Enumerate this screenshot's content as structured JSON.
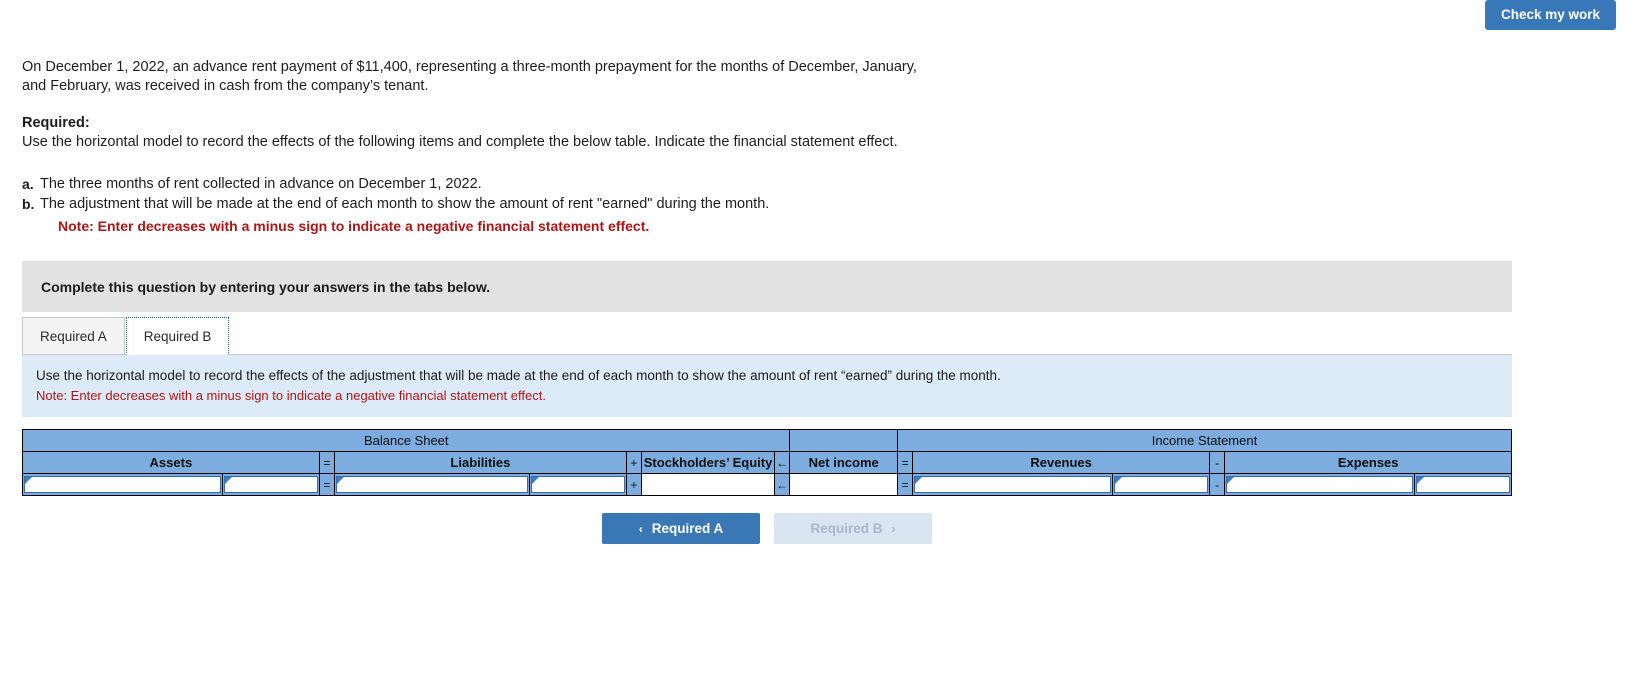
{
  "toolbar": {
    "check_my_work_label": "Check my work"
  },
  "prompt": {
    "paragraph": "On December 1, 2022, an advance rent payment of $11,400, representing a three-month prepayment for the months of December, January, and February, was received in cash from the company’s tenant.",
    "required_title": "Required:",
    "required_text": "Use the horizontal model to record the effects of the following items and complete the below table. Indicate the financial statement effect.",
    "items": [
      {
        "marker": "a.",
        "text": "The three months of rent collected in advance on December 1, 2022."
      },
      {
        "marker": "b.",
        "text": "The adjustment that will be made at the end of each month to show the amount of rent \"earned\" during the month."
      }
    ],
    "note": "Note: Enter decreases with a minus sign to indicate a negative financial statement effect."
  },
  "instruction_bar": {
    "text": "Complete this question by entering your answers in the tabs below."
  },
  "tabs": [
    {
      "label": "Required A",
      "active": false
    },
    {
      "label": "Required B",
      "active": true
    }
  ],
  "info_band": {
    "line1": "Use the horizontal model to record the effects of the adjustment that will be made at the end of each month to show the amount of rent “earned” during the month.",
    "line2": "Note: Enter decreases with a minus sign to indicate a negative financial statement effect."
  },
  "table": {
    "groups": [
      {
        "label": "Balance Sheet"
      },
      {
        "label": "Income Statement"
      }
    ],
    "columns": [
      {
        "label": "Assets",
        "operator_after": "="
      },
      {
        "label": "Liabilities",
        "operator_after": "+"
      },
      {
        "label": "Stockholders’ Equity",
        "operator_after": "←"
      },
      {
        "label": "Net income",
        "operator_after": "="
      },
      {
        "label": "Revenues",
        "operator_after": "-"
      },
      {
        "label": "Expenses",
        "operator_after": ""
      }
    ],
    "row_values": {
      "assets_left": "",
      "assets_right": "",
      "liabilities_left": "",
      "liabilities_right": "",
      "stockholders_equity": "",
      "net_income": "",
      "revenues_left": "",
      "revenues_right": "",
      "expenses_left": "",
      "expenses_right": ""
    }
  },
  "nav": {
    "prev_label": "Required A",
    "next_label": "Required B",
    "prev_chevron": "‹",
    "next_chevron": "›"
  },
  "colors": {
    "accent_blue": "#3878b8",
    "table_header_blue": "#7cadde",
    "info_band_blue": "#dcebf7",
    "note_red": "#b01515",
    "grey_bar": "#e2e2e2"
  }
}
